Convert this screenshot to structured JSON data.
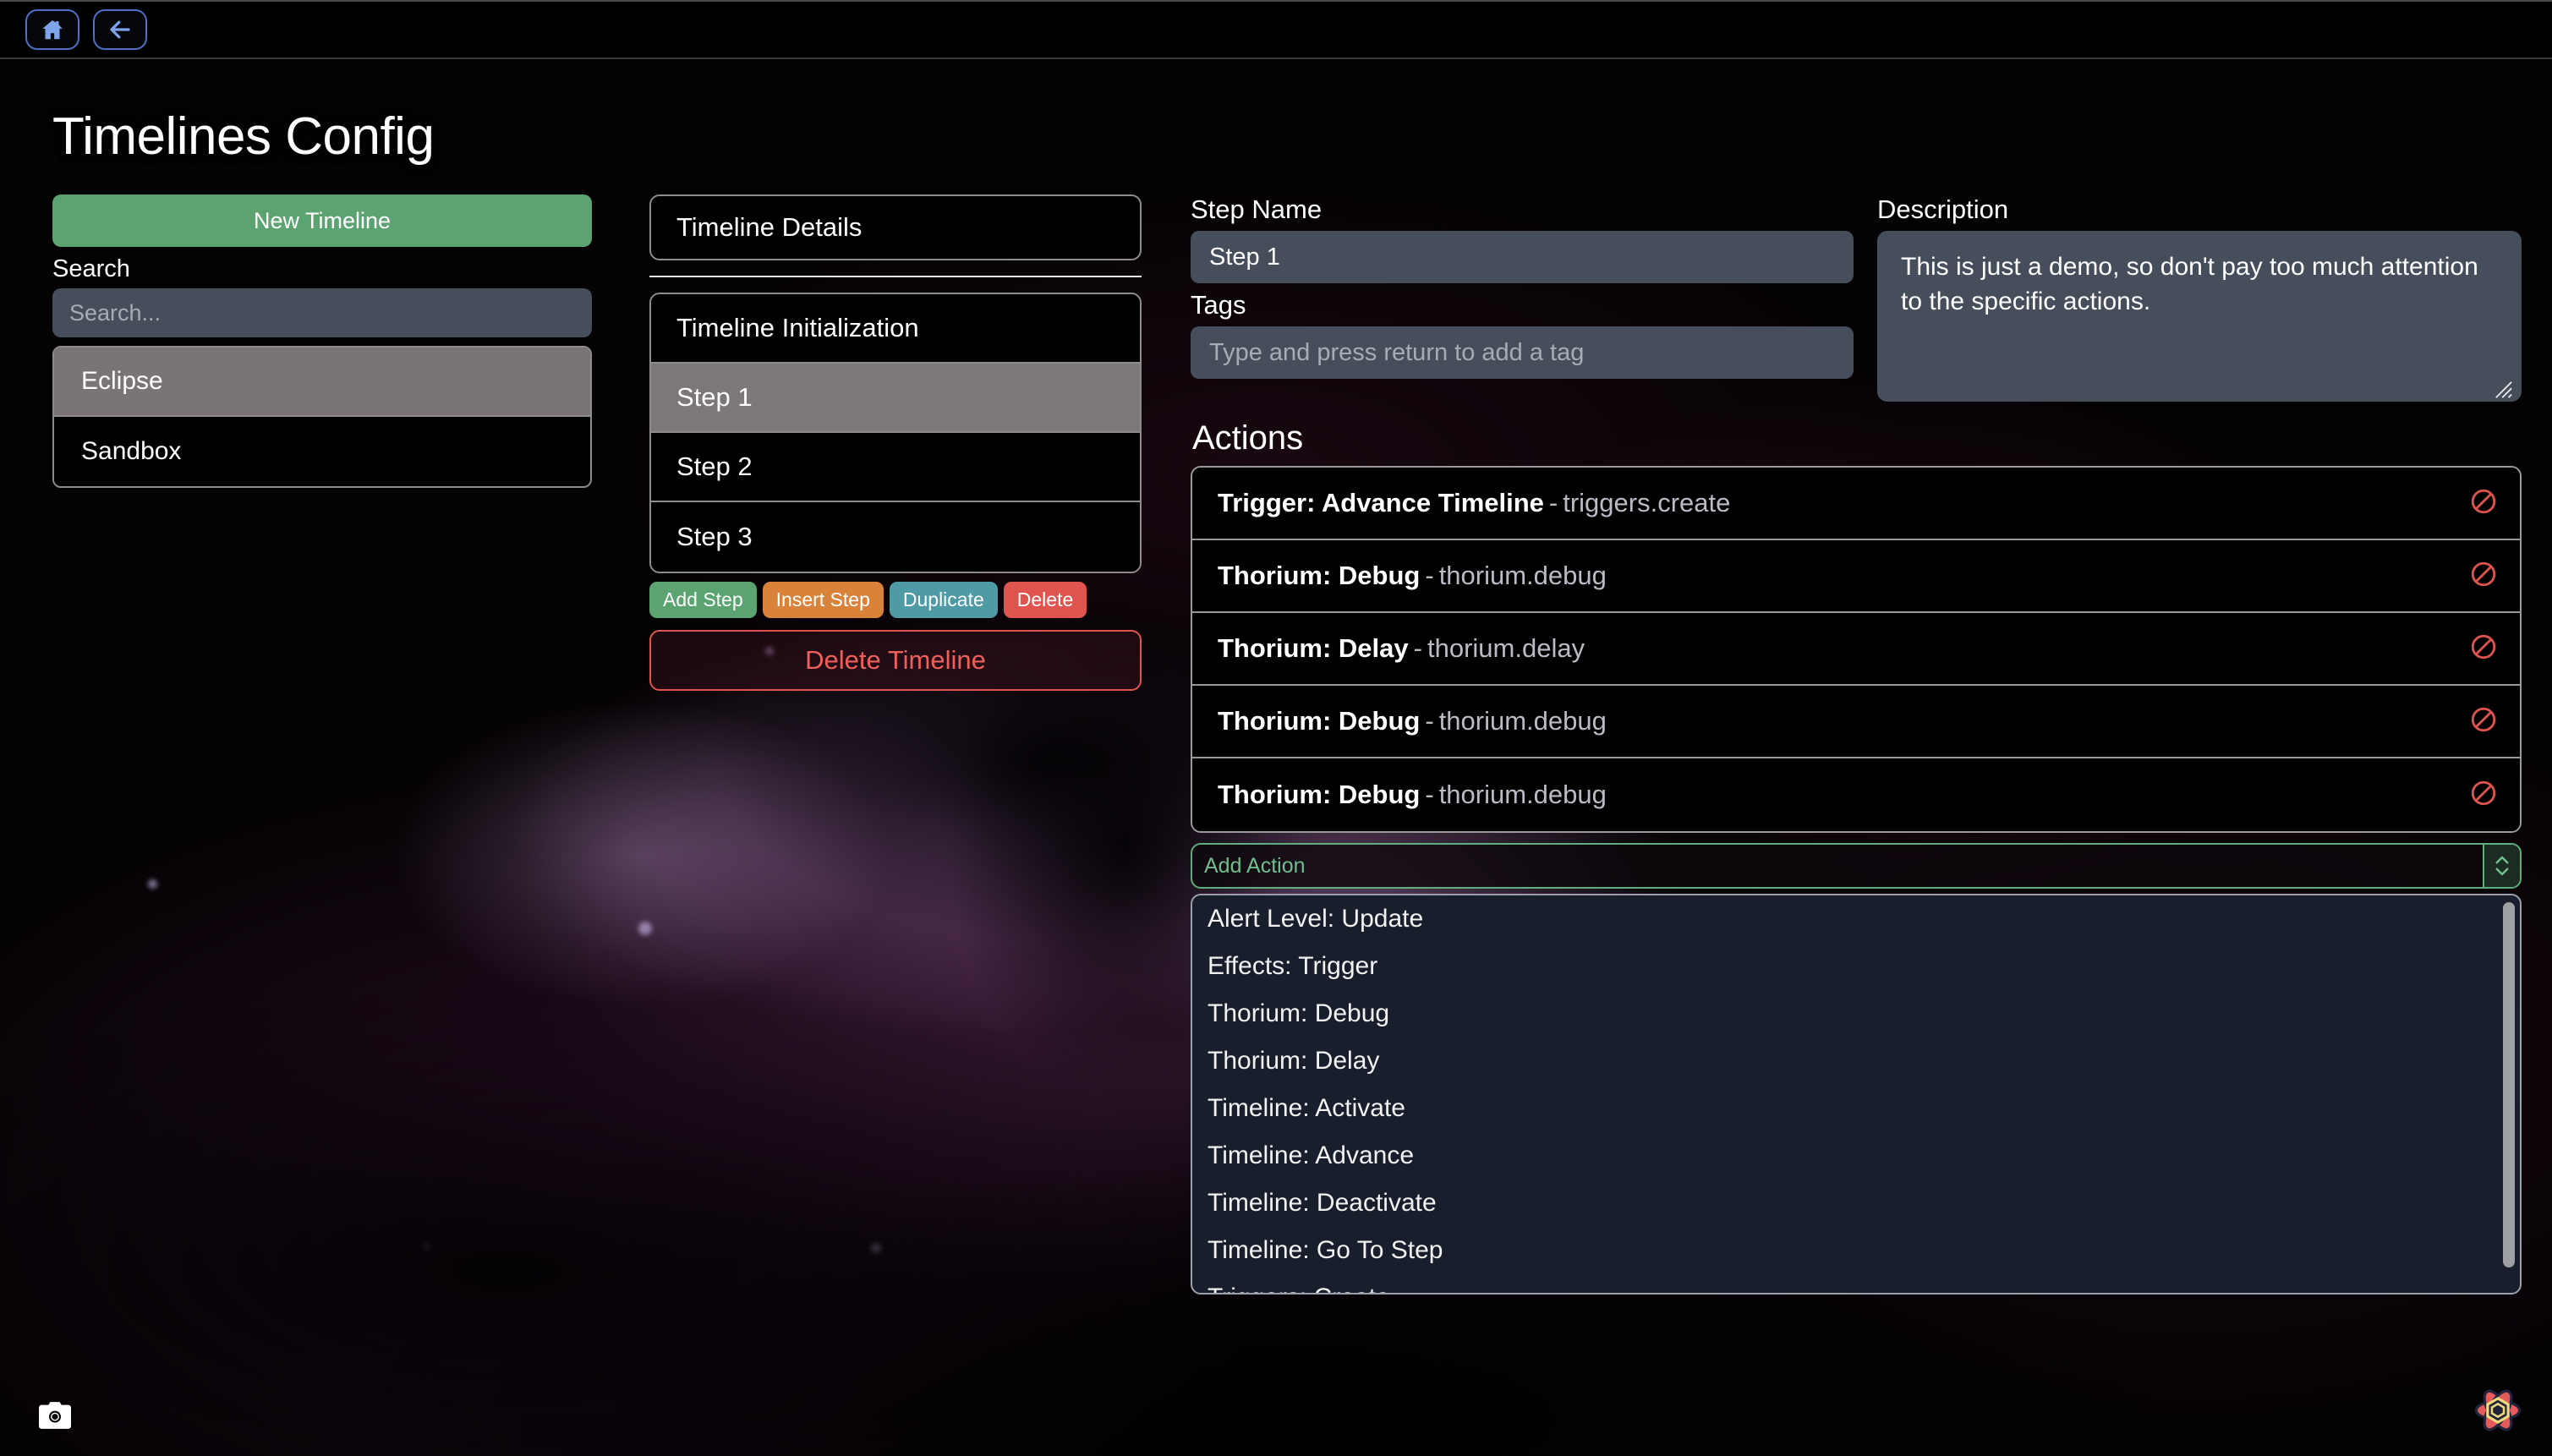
{
  "window": {
    "nav": {
      "home_icon": "home-icon",
      "back_icon": "arrow-left-icon"
    }
  },
  "page_title": "Timelines Config",
  "timelines_panel": {
    "new_timeline_label": "New Timeline",
    "search_label": "Search",
    "search_placeholder": "Search...",
    "search_value": "",
    "items": [
      {
        "label": "Eclipse",
        "selected": true
      },
      {
        "label": "Sandbox",
        "selected": false
      }
    ]
  },
  "details_panel": {
    "details_button_label": "Timeline Details",
    "steps": [
      {
        "label": "Timeline Initialization",
        "selected": false
      },
      {
        "label": "Step 1",
        "selected": true
      },
      {
        "label": "Step 2",
        "selected": false
      },
      {
        "label": "Step 3",
        "selected": false
      }
    ],
    "buttons": [
      {
        "label": "Add Step",
        "color": "#5ba471",
        "style": "green"
      },
      {
        "label": "Insert Step",
        "color": "#d98239",
        "style": "orange"
      },
      {
        "label": "Duplicate",
        "color": "#4e9aa5",
        "style": "teal"
      },
      {
        "label": "Delete",
        "color": "#e0544f",
        "style": "red"
      }
    ],
    "delete_timeline_label": "Delete Timeline"
  },
  "step_editor": {
    "step_name_label": "Step Name",
    "step_name_value": "Step 1",
    "tags_label": "Tags",
    "tags_placeholder": "Type and press return to add a tag",
    "tags_value": "",
    "description_label": "Description",
    "description_value": "This is just a demo, so don't pay too much attention to the specific actions.",
    "actions_title": "Actions",
    "actions": [
      {
        "title": "Trigger: Advance Timeline",
        "id": "triggers.create",
        "remove_icon": "ban-icon"
      },
      {
        "title": "Thorium: Debug",
        "id": "thorium.debug",
        "remove_icon": "ban-icon"
      },
      {
        "title": "Thorium: Delay",
        "id": "thorium.delay",
        "remove_icon": "ban-icon"
      },
      {
        "title": "Thorium: Debug",
        "id": "thorium.debug",
        "remove_icon": "ban-icon"
      },
      {
        "title": "Thorium: Debug",
        "id": "thorium.debug",
        "remove_icon": "ban-icon"
      }
    ],
    "add_action": {
      "placeholder": "Add Action",
      "value": "",
      "caret_icon": "chevron-up-down-icon",
      "options": [
        "Alert Level: Update",
        "Effects: Trigger",
        "Thorium: Debug",
        "Thorium: Delay",
        "Timeline: Activate",
        "Timeline: Advance",
        "Timeline: Deactivate",
        "Timeline: Go To Step",
        "Triggers: Create"
      ]
    }
  },
  "footer": {
    "camera_icon": "camera-icon",
    "logo_icon": "atom-logo-icon"
  },
  "colors": {
    "accent_green": "#5ba471",
    "accent_orange": "#d98239",
    "accent_teal": "#4e9aa5",
    "accent_red": "#e0544f",
    "field_bg": "#464e5c",
    "selected_row": "#7a7478",
    "combobox_border": "#5fae7d",
    "dropdown_bg": "#191e2c",
    "nav_icon": "#7fa4ee"
  }
}
